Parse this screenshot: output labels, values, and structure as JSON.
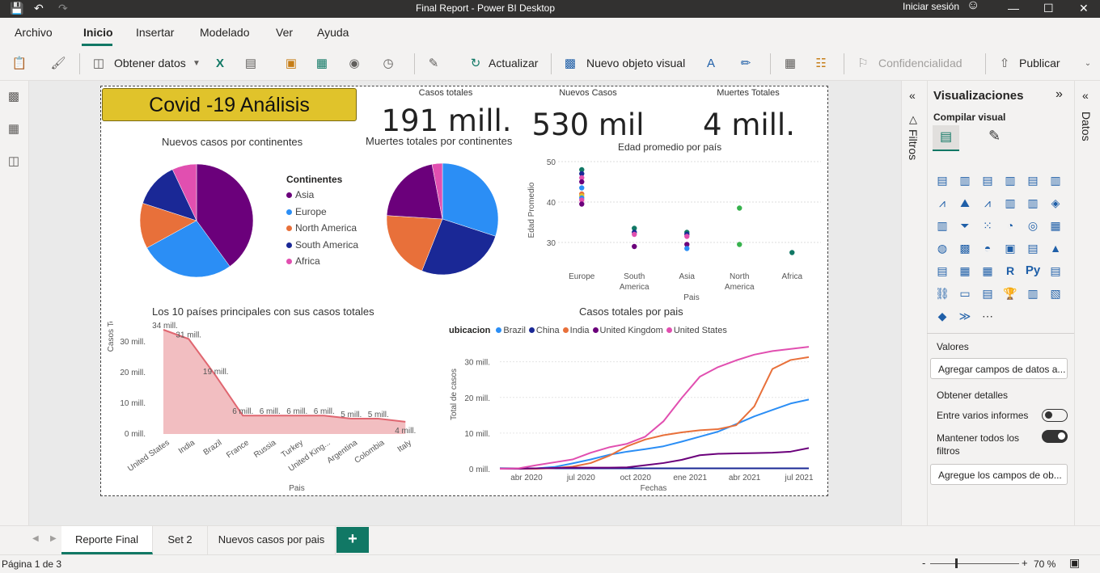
{
  "window": {
    "title": "Final Report - Power BI Desktop",
    "signin": "Iniciar sesión"
  },
  "menu": {
    "items": [
      "Archivo",
      "Inicio",
      "Insertar",
      "Modelado",
      "Ver",
      "Ayuda"
    ],
    "active": "Inicio"
  },
  "ribbon": {
    "get_data": "Obtener datos",
    "refresh": "Actualizar",
    "new_visual": "Nuevo objeto visual",
    "sensitivity": "Confidencialidad",
    "publish": "Publicar"
  },
  "report": {
    "title": "Covid -19 Análisis",
    "cards": [
      {
        "label": "Casos totales",
        "value": "191 mill."
      },
      {
        "label": "Nuevos Casos",
        "value": "530 mil"
      },
      {
        "label": "Muertes Totales",
        "value": "4 mill."
      }
    ]
  },
  "pie1": {
    "title": "Nuevos casos por continentes",
    "legend_title": "Continentes",
    "legend": [
      "Asia",
      "Europe",
      "North America",
      "South America",
      "Africa"
    ],
    "colors": [
      "#6b007b",
      "#2b8ef5",
      "#e8703a",
      "#1a2896",
      "#e14fb0"
    ]
  },
  "pie2": {
    "title": "Muertes totales por continentes"
  },
  "scatter": {
    "title": "Edad promedio por país",
    "ylabel": "Edad Promedio",
    "xlabel": "Pais",
    "yticks": [
      "50",
      "40",
      "30"
    ],
    "categories": [
      "Europe",
      "South\nAmerica",
      "Asia",
      "North\nAmerica",
      "Africa"
    ]
  },
  "area": {
    "title": "Los 10 países principales con sus casos totales",
    "ylabel": "Casos Totales",
    "xlabel": "Pais",
    "yticks": [
      "30 mill.",
      "20 mill.",
      "10 mill.",
      "0 mill."
    ],
    "data_labels": [
      "34 mill.",
      "31 mill.",
      "19 mill.",
      "6 mill.",
      "6 mill.",
      "6 mill.",
      "6 mill.",
      "5 mill.",
      "5 mill.",
      "4 mill."
    ]
  },
  "line": {
    "title": "Casos totales por pais",
    "legend_title": "ubicacion",
    "legend": [
      "Brazil",
      "China",
      "India",
      "United Kingdom",
      "United States"
    ],
    "colors": [
      "#2b8ef5",
      "#1a2896",
      "#e8703a",
      "#6b007b",
      "#e14fb0"
    ],
    "ylabel": "Total de casos",
    "xlabel": "Fechas",
    "yticks": [
      "30 mill.",
      "20 mill.",
      "10 mill.",
      "0 mill."
    ],
    "xticks": [
      "abr 2020",
      "jul 2020",
      "oct 2020",
      "ene 2021",
      "abr 2021",
      "jul 2021"
    ]
  },
  "chart_data": [
    {
      "type": "pie",
      "title": "Nuevos casos por continentes",
      "categories": [
        "Asia",
        "Europe",
        "North America",
        "South America",
        "Africa"
      ],
      "values": [
        40,
        27,
        13,
        13,
        7
      ]
    },
    {
      "type": "pie",
      "title": "Muertes totales por continentes",
      "categories": [
        "Europe",
        "South America",
        "North America",
        "Asia",
        "Africa"
      ],
      "values": [
        30,
        26,
        20,
        21,
        3
      ]
    },
    {
      "type": "scatter",
      "title": "Edad promedio por país",
      "xlabel": "Pais",
      "ylabel": "Edad Promedio",
      "ylim": [
        26,
        52
      ],
      "categories": [
        "Europe",
        "South America",
        "Asia",
        "North America",
        "Africa"
      ],
      "points": [
        {
          "x": "Europe",
          "y": [
            48,
            47,
            46,
            45,
            43.5,
            42,
            41.5,
            41,
            40.5,
            39.5
          ]
        },
        {
          "x": "South America",
          "y": [
            33.5,
            32.5,
            32,
            29
          ]
        },
        {
          "x": "Asia",
          "y": [
            32.5,
            32,
            31.5,
            29.5,
            28.5
          ]
        },
        {
          "x": "North America",
          "y": [
            38.5,
            29.5
          ]
        },
        {
          "x": "Africa",
          "y": [
            27.5
          ]
        }
      ]
    },
    {
      "type": "area",
      "title": "Los 10 países principales con sus casos totales",
      "xlabel": "Pais",
      "ylabel": "Casos Totales",
      "ylim": [
        0,
        34
      ],
      "categories": [
        "United States",
        "India",
        "Brazil",
        "France",
        "Russia",
        "Turkey",
        "United King...",
        "Argentina",
        "Colombia",
        "Italy"
      ],
      "values": [
        34,
        31,
        19,
        6,
        6,
        6,
        6,
        5,
        5,
        4
      ]
    },
    {
      "type": "line",
      "title": "Casos totales por pais",
      "xlabel": "Fechas",
      "ylabel": "Total de casos",
      "ylim": [
        0,
        35
      ],
      "x": [
        "feb 2020",
        "mar 2020",
        "abr 2020",
        "may 2020",
        "jun 2020",
        "jul 2020",
        "ago 2020",
        "sep 2020",
        "oct 2020",
        "nov 2020",
        "dic 2020",
        "ene 2021",
        "feb 2021",
        "mar 2021",
        "abr 2021",
        "may 2021",
        "jun 2021",
        "jul 2021"
      ],
      "series": [
        {
          "name": "Brazil",
          "values": [
            0,
            0,
            0.1,
            0.5,
            1.5,
            2.6,
            3.9,
            4.8,
            5.5,
            6.3,
            7.6,
            9,
            10.4,
            12.5,
            14.7,
            16.5,
            18.3,
            19.4
          ]
        },
        {
          "name": "China",
          "values": [
            0.1,
            0.1,
            0.1,
            0.1,
            0.1,
            0.1,
            0.1,
            0.1,
            0.1,
            0.1,
            0.1,
            0.1,
            0.1,
            0.1,
            0.1,
            0.1,
            0.1,
            0.1
          ]
        },
        {
          "name": "India",
          "values": [
            0,
            0,
            0,
            0.2,
            0.6,
            1.6,
            3.6,
            6.3,
            8.2,
            9.4,
            10.2,
            10.8,
            11.1,
            12.2,
            17.5,
            28,
            30.5,
            31.3
          ]
        },
        {
          "name": "United Kingdom",
          "values": [
            0,
            0,
            0.1,
            0.2,
            0.3,
            0.3,
            0.3,
            0.4,
            1,
            1.6,
            2.5,
            3.8,
            4.2,
            4.3,
            4.4,
            4.5,
            4.8,
            5.8
          ]
        },
        {
          "name": "United States",
          "values": [
            0,
            0.1,
            1,
            1.8,
            2.6,
            4.5,
            6,
            7,
            9,
            13.3,
            19.8,
            25.8,
            28.5,
            30.4,
            32,
            33,
            33.6,
            34.2
          ]
        }
      ]
    }
  ],
  "filters": {
    "label": "Filtros"
  },
  "viz": {
    "title": "Visualizaciones",
    "build": "Compilar visual",
    "values_label": "Valores",
    "values_placeholder": "Agregar campos de datos a...",
    "drill_label": "Obtener detalles",
    "cross_report": "Entre varios informes",
    "keep_filters": "Mantener todos los filtros",
    "drill_placeholder": "Agregue los campos de ob..."
  },
  "data": {
    "label": "Datos"
  },
  "tabs": [
    "Reporte Final",
    "Set 2",
    "Nuevos casos por pais"
  ],
  "status": {
    "page": "Página 1 de 3",
    "zoom": "70 %"
  }
}
